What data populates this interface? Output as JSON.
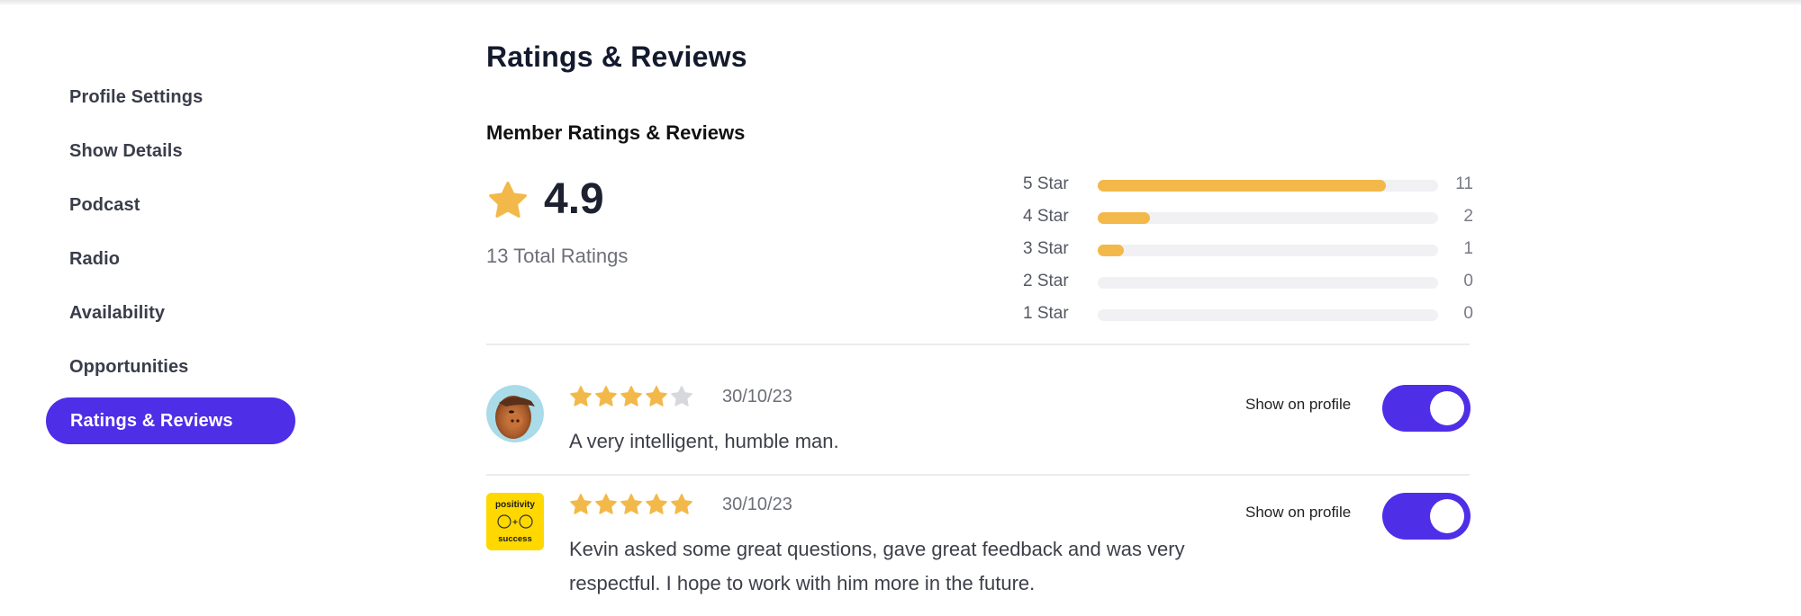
{
  "sidebar": {
    "items": [
      {
        "label": "Profile Settings",
        "active": false
      },
      {
        "label": "Show Details",
        "active": false
      },
      {
        "label": "Podcast",
        "active": false
      },
      {
        "label": "Radio",
        "active": false
      },
      {
        "label": "Availability",
        "active": false
      },
      {
        "label": "Opportunities",
        "active": false
      },
      {
        "label": "Ratings & Reviews",
        "active": true
      }
    ]
  },
  "main": {
    "title": "Ratings & Reviews",
    "section_title": "Member Ratings & Reviews",
    "summary": {
      "star_icon": "star-icon",
      "average": "4.9",
      "total_label": "13 Total Ratings"
    },
    "breakdown": {
      "max": 13,
      "rows": [
        {
          "label": "5 Star",
          "count": 11
        },
        {
          "label": "4 Star",
          "count": 2
        },
        {
          "label": "3 Star",
          "count": 1
        },
        {
          "label": "2 Star",
          "count": 0
        },
        {
          "label": "1 Star",
          "count": 0
        }
      ]
    },
    "reviews": [
      {
        "avatar": "alf-portrait-avatar",
        "rating": 4,
        "max_rating": 5,
        "date": "30/10/23",
        "text": "A very intelligent, humble man.",
        "toggle_label": "Show on profile",
        "show_on_profile": true
      },
      {
        "avatar": "positivity-success-logo",
        "avatar_text_top": "positivity",
        "avatar_text_bottom": "success",
        "rating": 5,
        "max_rating": 5,
        "date": "30/10/23",
        "text": "Kevin asked some great questions, gave great feedback and was very respectful. I hope to work with him more in the future.",
        "toggle_label": "Show on profile",
        "show_on_profile": true
      }
    ]
  },
  "colors": {
    "accent": "#4f2ee8",
    "star": "#f2b94a",
    "star_empty": "#d6d8de",
    "track": "#f1f1f4",
    "logo_yellow": "#ffd800"
  }
}
